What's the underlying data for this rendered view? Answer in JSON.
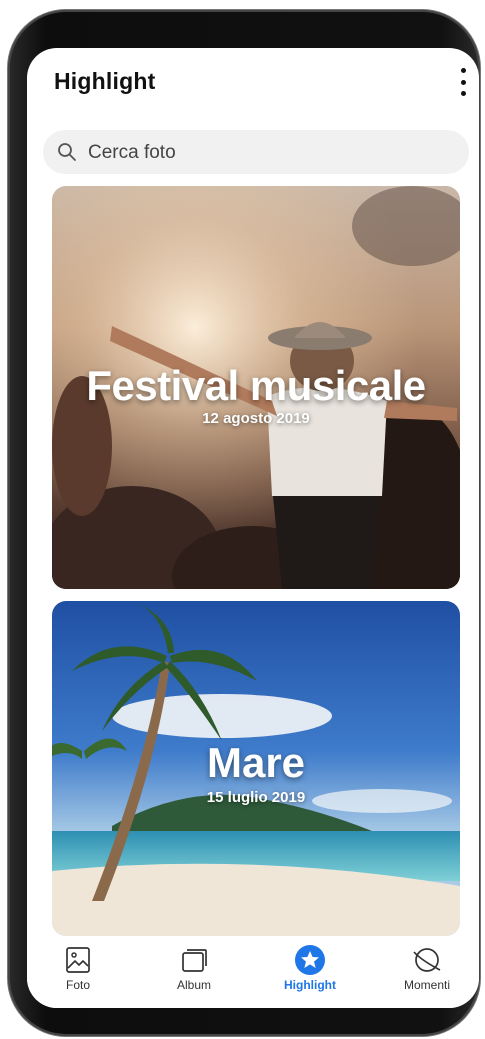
{
  "header": {
    "title": "Highlight",
    "menu_icon": "more-vertical-icon"
  },
  "search": {
    "placeholder": "Cerca foto",
    "icon": "search-icon"
  },
  "cards": [
    {
      "title": "Festival musicale",
      "date": "12 agosto 2019"
    },
    {
      "title": "Mare",
      "date": "15 luglio 2019"
    }
  ],
  "bottom_nav": {
    "items": [
      {
        "label": "Foto",
        "icon": "image-icon",
        "active": false
      },
      {
        "label": "Album",
        "icon": "album-icon",
        "active": false
      },
      {
        "label": "Highlight",
        "icon": "star-icon",
        "active": true
      },
      {
        "label": "Momenti",
        "icon": "planet-icon",
        "active": false
      }
    ]
  },
  "colors": {
    "accent": "#1f76e6",
    "search_bg": "#f1f1f1"
  }
}
